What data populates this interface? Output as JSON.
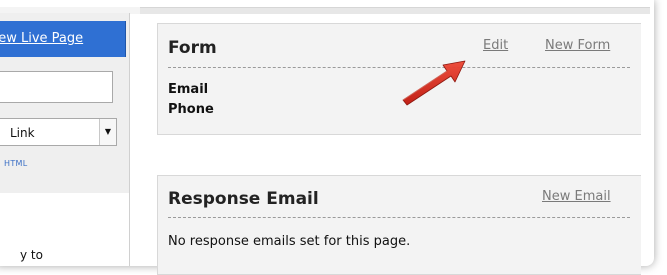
{
  "sidebar": {
    "live_page_link": "View Live Page",
    "select_value": "Link",
    "small_link": "HTML",
    "text_fragment": "y to"
  },
  "form_panel": {
    "title": "Form",
    "edit_link": "Edit",
    "new_form_link": "New Form",
    "fields": [
      "Email",
      "Phone"
    ]
  },
  "response_panel": {
    "title": "Response Email",
    "new_email_link": "New Email",
    "message": "No response emails set for this page."
  },
  "colors": {
    "accent_blue": "#2f70d3",
    "arrow_red": "#d8261a"
  }
}
